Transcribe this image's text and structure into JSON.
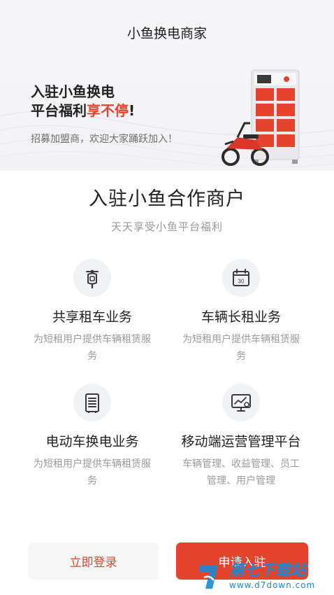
{
  "header": {
    "title": "小鱼换电商家"
  },
  "banner": {
    "line1": "入驻小鱼换电",
    "line2_prefix": "平台福利",
    "line2_highlight": "享不停",
    "line2_suffix": "!",
    "subtitle": "招募加盟商，欢迎大家踊跃加入！"
  },
  "intro": {
    "title": "入驻小鱼合作商户",
    "subtitle": "天天享受小鱼平台福利"
  },
  "features": [
    {
      "name": "共享租车业务",
      "desc": "为短租用户提供车辆租赁服务",
      "icon": "scooter-icon"
    },
    {
      "name": "车辆长租业务",
      "desc": "为短租用户提供车辆租赁服务",
      "icon": "calendar-icon",
      "icon_text": "30"
    },
    {
      "name": "电动车换电业务",
      "desc": "为短租用户提供车辆租赁服务",
      "icon": "battery-cabinet-icon"
    },
    {
      "name": "移动端运营管理平台",
      "desc": "车辆管理、收益管理、员工管理、用户管理",
      "icon": "monitor-chart-icon"
    }
  ],
  "actions": {
    "login_label": "立即登录",
    "apply_label": "申请入驻"
  },
  "watermark": {
    "main": "第七下载站",
    "url": "www.d7down.com"
  },
  "colors": {
    "accent": "#e4432c",
    "text_dark": "#222222",
    "text_muted": "#9a9a9a",
    "background_light": "#f5f5f7"
  }
}
